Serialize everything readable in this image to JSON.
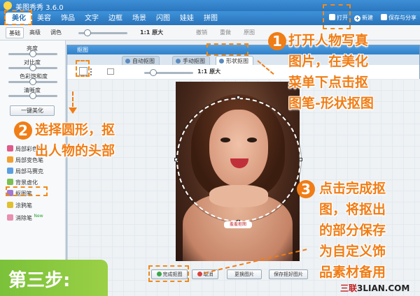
{
  "app": {
    "title": "美图秀秀 3.6.0"
  },
  "menu": {
    "tabs": [
      "美化",
      "美容",
      "饰品",
      "文字",
      "边框",
      "场景",
      "闪图",
      "娃娃",
      "拼图"
    ],
    "open_label": "打开",
    "new_label": "新建",
    "save_label": "保存与分享"
  },
  "toolbar": {
    "subtabs": [
      "基础",
      "高级",
      "调色"
    ],
    "zoom_label": "1:1 原大",
    "undo_label": "撤销",
    "redo_label": "重做",
    "reset_label": "原图"
  },
  "left_panel": {
    "sliders": [
      "亮度",
      "对比度",
      "色彩饱和度",
      "清晰度"
    ],
    "one_click_label": "一键美化",
    "tools": [
      "局部彩色笔",
      "局部变色笔",
      "局部马赛克",
      "背景虚化",
      "抠图笔",
      "涂鸦笔",
      "消除笔"
    ],
    "new_badge": "New"
  },
  "dialog": {
    "title": "抠图",
    "tabs": [
      "自动抠图",
      "手动抠图",
      "形状抠图"
    ],
    "zoom_label": "1:1 原大",
    "cut_badge": "羞羞抠图",
    "buttons": {
      "done": "完成抠图",
      "cancel": "取消",
      "replace": "更换图片",
      "save": "保存抠好图片"
    }
  },
  "annotations": {
    "step1_num": "1",
    "step1_text": [
      "打开人物写真",
      "图片，在美化",
      "菜单下点击抠",
      "图笔-形状抠图"
    ],
    "step2_num": "2",
    "step2_text": [
      "选择圆形，抠",
      "出人物的头部"
    ],
    "step3_num": "3",
    "step3_text": [
      "点击完成抠",
      "图，将抠出",
      "的部分保存",
      "为自定义饰",
      "品素材备用"
    ],
    "step_label": "第三步:"
  },
  "watermark": {
    "prefix": "三联",
    "suffix": "3LIAN.COM"
  },
  "colors": {
    "accent": "#f07d16",
    "menu_blue": "#2a72b8",
    "step_green": "#7bc13a"
  }
}
